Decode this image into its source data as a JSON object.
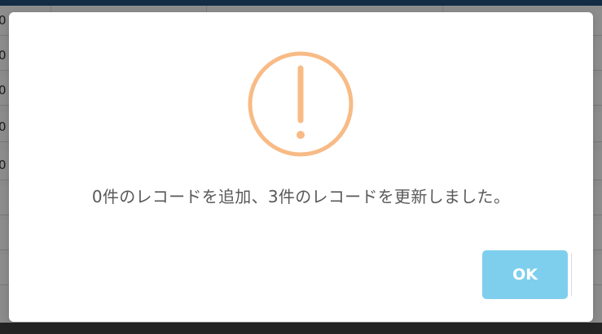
{
  "background": {
    "row_values": [
      "0",
      "0",
      "0",
      "0",
      "0"
    ]
  },
  "dialog": {
    "icon": "exclamation-circle-icon",
    "icon_color": "#f8bb86",
    "message": "0件のレコードを追加、3件のレコードを更新しました。",
    "ok_label": "OK",
    "ok_color": "#7ecfee"
  }
}
